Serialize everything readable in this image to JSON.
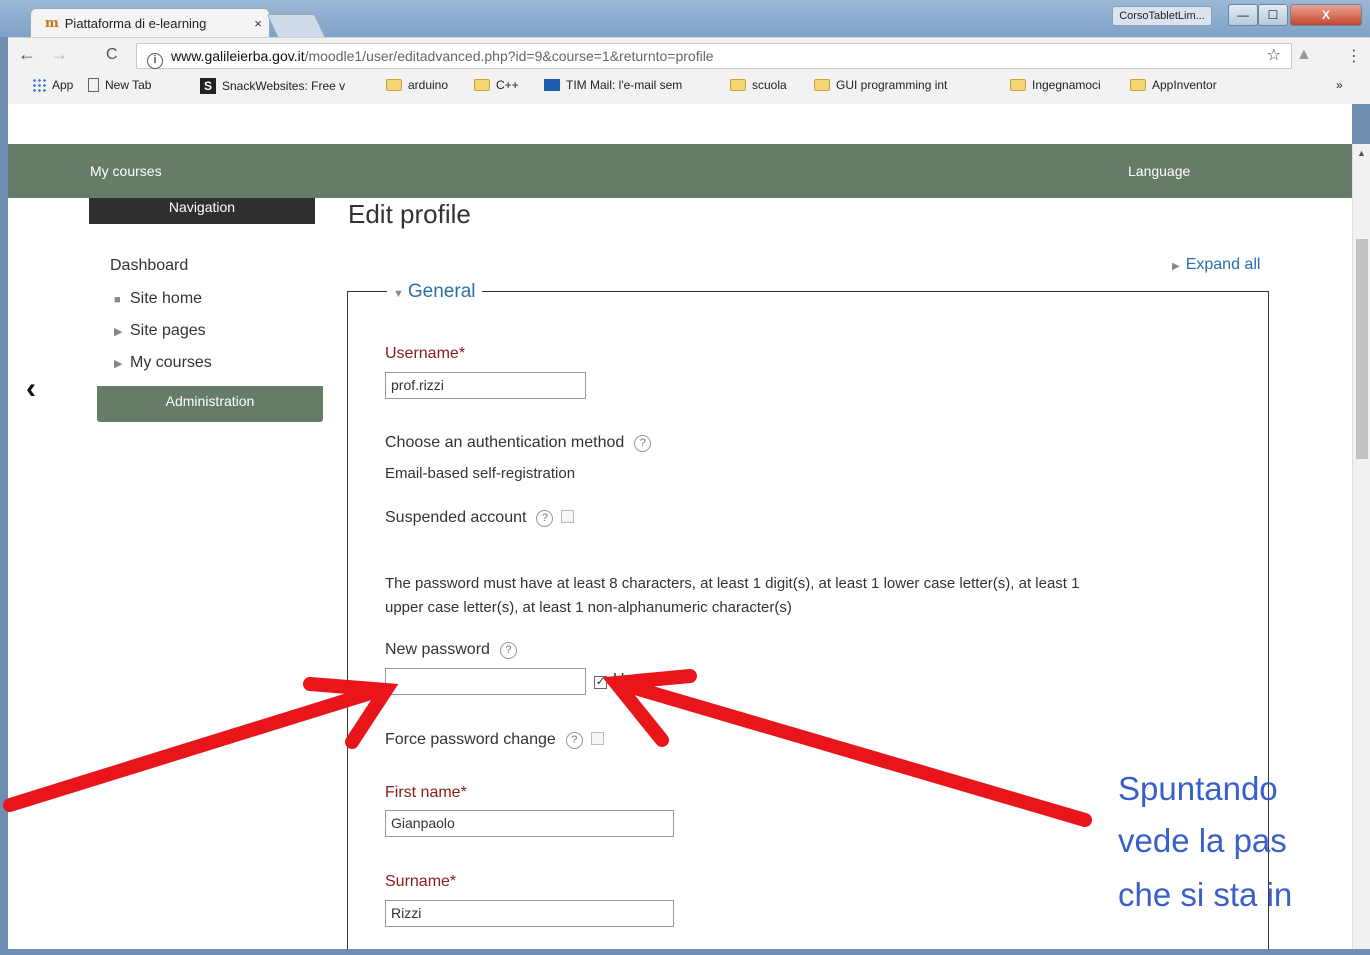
{
  "window": {
    "taskbar_label": "CorsoTabletLim...",
    "minimize": "—",
    "maximize": "☐",
    "close": "X"
  },
  "tab": {
    "favicon": "m",
    "title": "Piattaforma di e-learning",
    "close": "×"
  },
  "address": {
    "back": "←",
    "forward": "→",
    "reload": "C",
    "info": "i",
    "domain": "www.galileierba.gov.it",
    "path": "/moodle1/user/editadvanced.php?id=9&course=1&returnto=profile",
    "star": "☆",
    "menu": "⋮"
  },
  "bookmarks": {
    "items": [
      "App",
      "New Tab",
      "SnackWebsites: Free v",
      "arduino",
      "C++",
      "TIM Mail: l'e-mail sem",
      "scuola",
      "GUI programming int",
      "Ingegnamoci",
      "AppInventor"
    ],
    "overflow": "»"
  },
  "navbar": {
    "my_courses": "My courses",
    "language": "Language"
  },
  "sidebar": {
    "navigation_title": "Navigation",
    "dashboard": "Dashboard",
    "items": [
      {
        "bullet": "■",
        "label": "Site home"
      },
      {
        "bullet": "▶",
        "label": "Site pages"
      },
      {
        "bullet": "▶",
        "label": "My courses"
      }
    ],
    "administration_title": "Administration",
    "back_arrow": "‹"
  },
  "main": {
    "title": "Edit profile",
    "expand_all": "Expand all",
    "section_title": "General",
    "username_label": "Username",
    "required_mark": "*",
    "username_value": "prof.rizzi",
    "auth_label": "Choose an authentication method",
    "auth_value": "Email-based self-registration",
    "suspended_label": "Suspended account",
    "password_rule_line1": "The password must have at least 8 characters, at least 1 digit(s), at least 1 lower case letter(s), at least 1",
    "password_rule_line2": "upper case letter(s), at least 1 non-alphanumeric character(s)",
    "new_password_label": "New password",
    "new_password_value": "",
    "unmask_label": "Unmask",
    "unmask_checked": true,
    "force_change_label": "Force password change",
    "first_name_label": "First name",
    "first_name_value": "Gianpaolo",
    "surname_label": "Surname",
    "surname_value": "Rizzi",
    "help_glyph": "?"
  },
  "annotation": {
    "line1": "Spuntando",
    "line2": "vede la pas",
    "line3": "che si sta in",
    "color": "#3a5fc9",
    "arrow_color": "#e8151b"
  }
}
